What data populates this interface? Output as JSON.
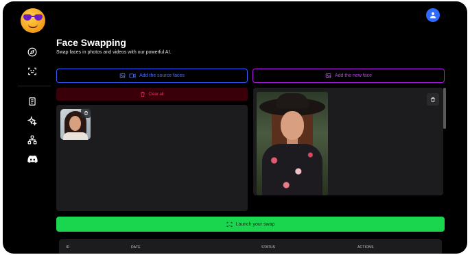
{
  "app": {
    "brand_colors": {
      "primary": "#2f5bff",
      "accent": "#b419e6",
      "danger": "#ff2d6b",
      "success": "#19d64e"
    }
  },
  "sidebar": {
    "items": [
      {
        "icon": "compass-icon"
      },
      {
        "icon": "face-scan-icon"
      },
      {
        "icon": "document-icon"
      },
      {
        "icon": "sparkles-icon"
      },
      {
        "icon": "hierarchy-icon"
      },
      {
        "icon": "discord-icon"
      }
    ]
  },
  "header": {
    "avatar_icon": "user-icon"
  },
  "page": {
    "title": "Face Swapping",
    "subtitle": "Swap faces in photos and videos with our powerful AI."
  },
  "source": {
    "add_label": "Add the source faces",
    "clear_label": "Clear all"
  },
  "target": {
    "add_label": "Add the new face"
  },
  "actions": {
    "launch_label": "Launch your swap"
  },
  "table": {
    "columns": [
      "ID",
      "DATE",
      "STATUS",
      "ACTIONS"
    ]
  }
}
